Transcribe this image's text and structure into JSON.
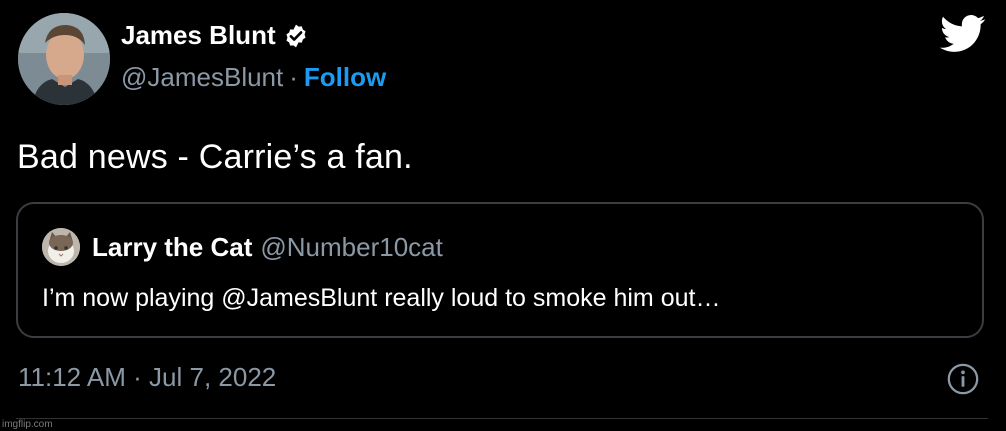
{
  "author": {
    "name": "James Blunt",
    "handle": "@JamesBlunt",
    "separator": "·",
    "follow_label": "Follow",
    "verified": true
  },
  "tweet": {
    "text": "Bad news - Carrie’s a fan."
  },
  "quoted_tweet": {
    "name": "Larry the Cat",
    "handle": "@Number10cat",
    "text": "I’m now playing @JamesBlunt really loud to smoke him out…"
  },
  "meta": {
    "timestamp": "11:12 AM · Jul 7, 2022"
  },
  "watermark": "imgflip.com",
  "colors": {
    "background": "#000000",
    "link": "#1d9bf0",
    "muted": "#8b98a5",
    "border": "#3a3d41"
  },
  "icons": [
    "verified-badge-icon",
    "twitter-bird-icon",
    "info-icon"
  ]
}
